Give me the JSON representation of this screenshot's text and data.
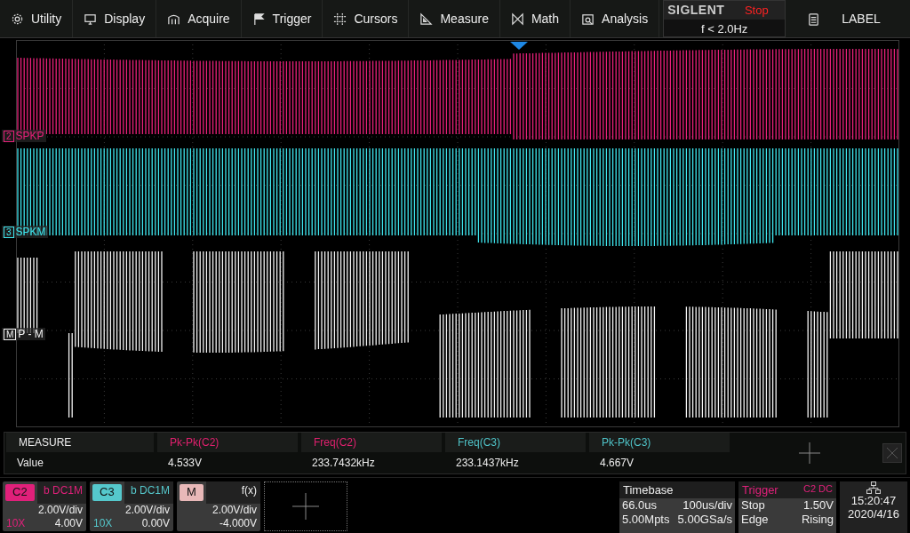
{
  "menu": [
    {
      "label": "Utility",
      "kind": "gear"
    },
    {
      "label": "Display",
      "kind": "monitor"
    },
    {
      "label": "Acquire",
      "kind": "acquire"
    },
    {
      "label": "Trigger",
      "kind": "flag"
    },
    {
      "label": "Cursors",
      "kind": "cursor"
    },
    {
      "label": "Measure",
      "kind": "ruler"
    },
    {
      "label": "Math",
      "kind": "math"
    },
    {
      "label": "Analysis",
      "kind": "analysis"
    }
  ],
  "brand": "SIGLENT",
  "run_state": "Stop",
  "trigger_frequency": "f < 2.0Hz",
  "label_button": "LABEL",
  "traces": [
    {
      "marker": "2",
      "name": "SPKP",
      "color": "#e8207a"
    },
    {
      "marker": "3",
      "name": "SPKM",
      "color": "#3ee6ee"
    },
    {
      "marker": "M",
      "name": "P - M",
      "color": "#f4f4f4"
    }
  ],
  "measure": {
    "title": "MEASURE",
    "row_label": "Value",
    "items": [
      {
        "name": "Pk-Pk(C2)",
        "value": "4.533V",
        "color": "#e0206e"
      },
      {
        "name": "Freq(C2)",
        "value": "233.7432kHz",
        "color": "#e0206e"
      },
      {
        "name": "Freq(C3)",
        "value": "233.1437kHz",
        "color": "#4fc3c8"
      },
      {
        "name": "Pk-Pk(C3)",
        "value": "4.667V",
        "color": "#4fc3c8"
      }
    ]
  },
  "channels": [
    {
      "name": "C2",
      "prefix": "b",
      "coupling": "DC1M",
      "scale": "2.00V/div",
      "probe": "10X",
      "offset": "4.00V",
      "color": "#e0207a"
    },
    {
      "name": "C3",
      "prefix": "b",
      "coupling": "DC1M",
      "scale": "2.00V/div",
      "probe": "10X",
      "offset": "0.00V",
      "color": "#55c8cc"
    },
    {
      "name": "M",
      "coupling": "f(x)",
      "scale": "2.00V/div",
      "offset": "-4.000V",
      "color": "#e8b8b8"
    }
  ],
  "timebase": {
    "title": "Timebase",
    "delay": "66.0us",
    "scale": "100us/div",
    "memory": "5.00Mpts",
    "sample_rate": "5.00GSa/s"
  },
  "trigger": {
    "title": "Trigger",
    "source": "C2",
    "coupling": "DC",
    "state": "Stop",
    "level": "1.50V",
    "type": "Edge",
    "slope": "Rising"
  },
  "clock": {
    "time": "15:20:47",
    "date": "2020/4/16"
  }
}
